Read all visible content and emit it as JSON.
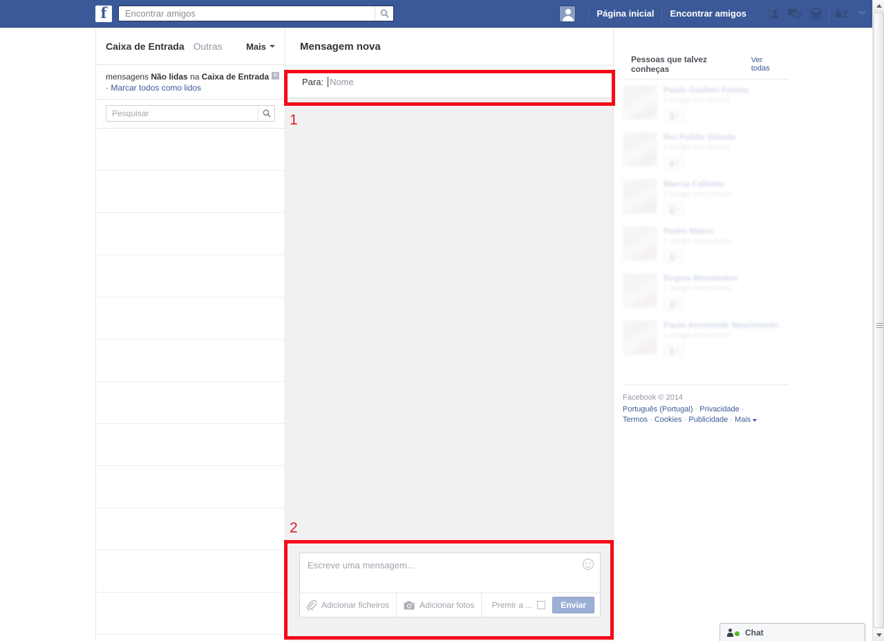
{
  "topbar": {
    "logo_letter": "f",
    "search_placeholder": "Encontrar amigos",
    "search_value": "",
    "search_icon": "search-icon",
    "me_name": "",
    "links": [
      {
        "label": "Página inicial"
      },
      {
        "label": "Encontrar amigos"
      }
    ],
    "icons": [
      {
        "name": "friend-requests-icon"
      },
      {
        "name": "messages-icon"
      },
      {
        "name": "notifications-globe-icon"
      },
      {
        "name": "privacy-shortcuts-icon"
      },
      {
        "name": "account-menu-caret-icon"
      }
    ]
  },
  "left": {
    "tab_inbox": "Caixa de Entrada",
    "tab_other": "Outras",
    "tab_more": "Mais",
    "banner": {
      "prefix": "mensagens ",
      "bold1": "Não lidas",
      "middle": " na ",
      "bold2": "Caixa de Entrada",
      "close_label": "×",
      "mark_prefix": "· ",
      "mark_all": "Marcar todos como lidos"
    },
    "search_placeholder": "Pesquisar",
    "search_value": "",
    "thread_count": 12
  },
  "center": {
    "title": "Mensagem nova",
    "to_label": "Para:",
    "to_placeholder": "Nome",
    "to_value": "",
    "markers": [
      {
        "text": "1"
      },
      {
        "text": "2"
      }
    ],
    "composer": {
      "message_placeholder": "Escreve uma mensagem...",
      "message_value": "",
      "emoji_icon": "smiley-icon",
      "add_files": "Adicionar ficheiros",
      "add_files_icon": "paperclip-icon",
      "add_photos": "Adicionar fotos",
      "add_photos_icon": "camera-icon",
      "press_enter": "Premir a ...",
      "send_label": "Enviar"
    }
  },
  "right": {
    "pymk_title": "Pessoas que talvez conheças",
    "pymk_see_all": "Ver todas",
    "people": [
      {
        "name": "Paulo Galdieri Freitas",
        "mutual": "1 amigo em comum",
        "add_icon": "add-friend-icon"
      },
      {
        "name": "Rui Pulido Valente",
        "mutual": "1 amigo em comum",
        "add_icon": "add-friend-icon"
      },
      {
        "name": "Marcia Caliento",
        "mutual": "1 amigo em comum",
        "add_icon": "add-friend-icon"
      },
      {
        "name": "Pedro Matos",
        "mutual": "1 amigo em comum",
        "add_icon": "add-friend-icon"
      },
      {
        "name": "Regina Montandon",
        "mutual": "1 amigo em comum",
        "add_icon": "add-friend-icon"
      },
      {
        "name": "Paulo Arcoverde Nascimento",
        "mutual": "1 amigo em comum",
        "add_icon": "add-friend-icon"
      }
    ],
    "footer": {
      "copyright": "Facebook © 2014",
      "links": [
        "Português (Portugal)",
        "Privacidade",
        "Termos",
        "Cookies",
        "Publicidade",
        "Mais"
      ]
    }
  },
  "chatbar": {
    "label": "Chat",
    "status_icon": "online-dot-icon",
    "person_icon": "person-icon"
  },
  "scrollbar": {
    "up_icon": "scroll-up-arrow-icon",
    "down_icon": "scroll-down-arrow-icon"
  },
  "colors": {
    "fb_blue": "#3b5998",
    "fb_blue_dark": "#29487d",
    "link_blue": "#3b5998",
    "annotation_red": "#f50b17",
    "page_bg": "#f1f1f2",
    "online_green": "#4fbb20"
  }
}
